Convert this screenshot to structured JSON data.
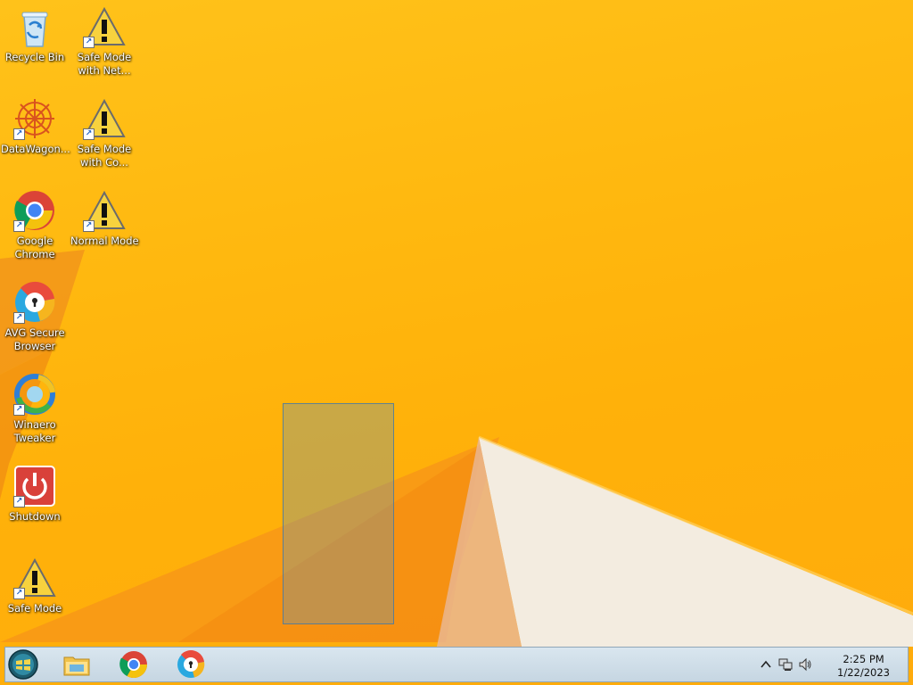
{
  "desktop": {
    "icons": [
      {
        "label": "Recycle Bin",
        "icon": "recycle-bin-icon"
      },
      {
        "label": "Safe Mode\nwith Net...",
        "icon": "warning-icon"
      },
      {
        "label": "DataWagon...",
        "icon": "datawagon-icon"
      },
      {
        "label": "Safe Mode\nwith Co...",
        "icon": "warning-icon"
      },
      {
        "label": "Google\nChrome",
        "icon": "chrome-icon"
      },
      {
        "label": "Normal Mode",
        "icon": "warning-icon"
      },
      {
        "label": "AVG Secure\nBrowser",
        "icon": "avg-browser-icon"
      },
      {
        "label": "Winaero\nTweaker",
        "icon": "winaero-icon"
      },
      {
        "label": "Shutdown",
        "icon": "power-icon"
      },
      {
        "label": "Safe Mode",
        "icon": "warning-icon"
      }
    ]
  },
  "taskbar": {
    "pinned": [
      "start-orb-icon",
      "file-explorer-icon",
      "chrome-icon",
      "avg-browser-icon"
    ],
    "tray": {
      "chevron": "show-hidden-icons-chevron",
      "network_icon": "network-icon",
      "volume_icon": "volume-icon",
      "time": "2:25 PM",
      "date": "1/22/2023"
    }
  },
  "colors": {
    "wallpaper": "#ffb80f",
    "taskbar": "#cfdde8",
    "selection": "#6496b4"
  }
}
